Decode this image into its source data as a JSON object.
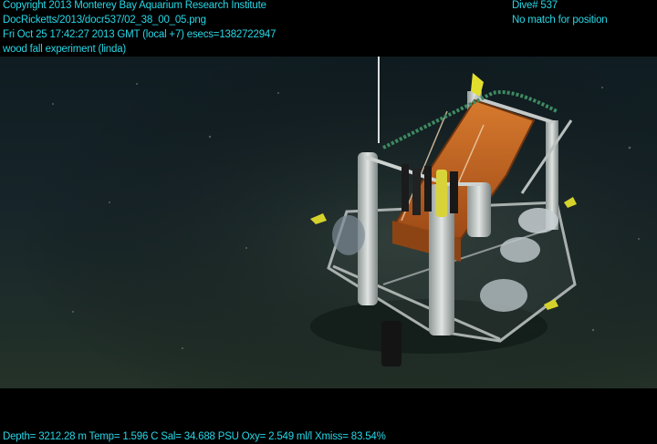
{
  "overlay": {
    "copyright": "Copyright 2013 Monterey Bay Aquarium Research Institute",
    "file_path": "DocRicketts/2013/docr537/02_38_00_05.png",
    "timestamp": "Fri Oct 25 17:42:27 2013 GMT (local +7)  esecs=1382722947",
    "experiment": "wood fall experiment (linda)",
    "dive": "Dive# 537",
    "position_status": "No match for position",
    "telemetry": "Depth= 3212.28 m  Temp= 1.596 C  Sal= 34.688 PSU  Oxy= 2.549 ml/l  Xmiss= 83.54%"
  },
  "colors": {
    "overlay_text": "#27d7e6",
    "seafloor": "#1c2a26",
    "lander_orange": "#c4621e",
    "frame_gray": "#b8bcbc"
  }
}
